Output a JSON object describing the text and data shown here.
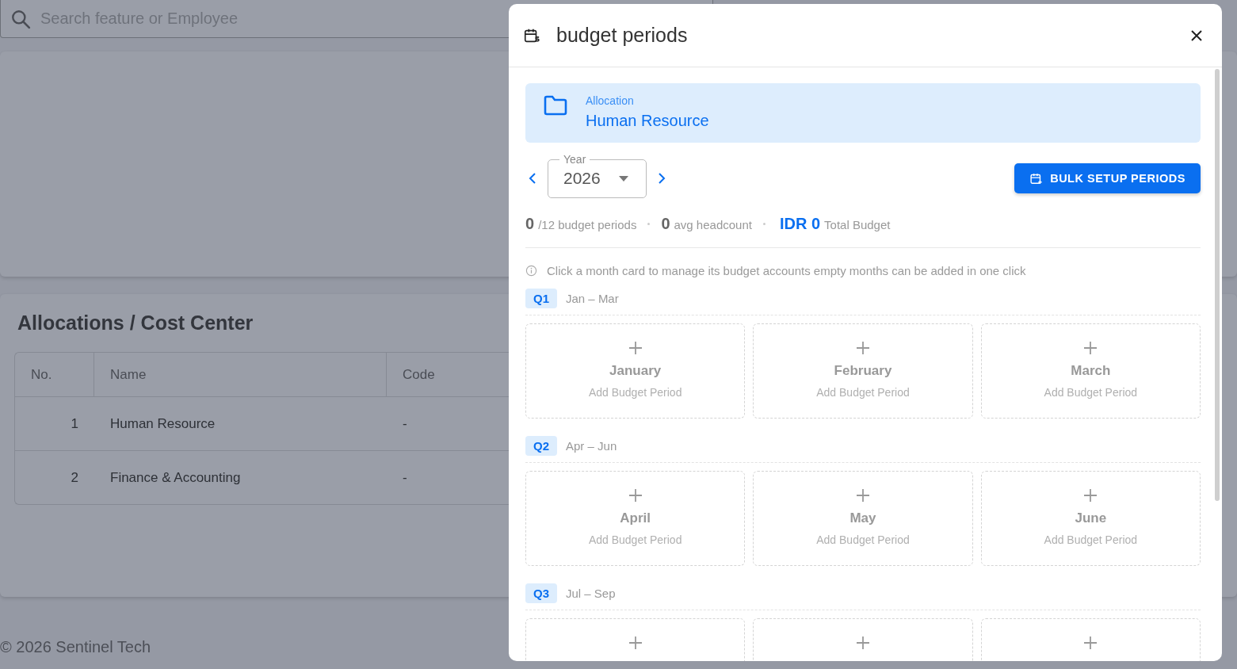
{
  "search": {
    "placeholder": "Search feature or Employee"
  },
  "allocations": {
    "title": "Allocations / Cost Center",
    "columns": [
      "No.",
      "Name",
      "Code"
    ],
    "rows": [
      {
        "no": "1",
        "name": "Human Resource",
        "code": "-"
      },
      {
        "no": "2",
        "name": "Finance & Accounting",
        "code": "-"
      }
    ]
  },
  "footer": "© 2026 Sentinel Tech",
  "dialog": {
    "title": "budget periods",
    "allocation": {
      "label": "Allocation",
      "value": "Human Resource"
    },
    "year": {
      "label": "Year",
      "value": "2026"
    },
    "bulk_button": "BULK SETUP PERIODS",
    "stats": [
      {
        "kind": "count",
        "value": "0",
        "label": "/12 budget periods"
      },
      {
        "kind": "count",
        "value": "0",
        "label": "avg headcount"
      },
      {
        "kind": "money",
        "value": "IDR 0",
        "label": "Total Budget"
      }
    ],
    "info": "Click a month card to manage its budget accounts empty months can be added in one click",
    "quarters": [
      {
        "label": "Q1",
        "range": "Jan – Mar",
        "months": [
          {
            "kind": "empty",
            "name": "January",
            "hint": "Add Budget Period"
          },
          {
            "kind": "empty",
            "name": "February",
            "hint": "Add Budget Period"
          },
          {
            "kind": "empty",
            "name": "March",
            "hint": "Add Budget Period"
          }
        ]
      },
      {
        "label": "Q2",
        "range": "Apr – Jun",
        "months": [
          {
            "kind": "empty",
            "name": "April",
            "hint": "Add Budget Period"
          },
          {
            "kind": "empty",
            "name": "May",
            "hint": "Add Budget Period"
          },
          {
            "kind": "empty",
            "name": "June",
            "hint": "Add Budget Period"
          }
        ]
      },
      {
        "label": "Q3",
        "range": "Jul – Sep",
        "months": [
          {
            "kind": "empty"
          },
          {
            "kind": "empty"
          },
          {
            "kind": "empty"
          }
        ]
      }
    ]
  }
}
